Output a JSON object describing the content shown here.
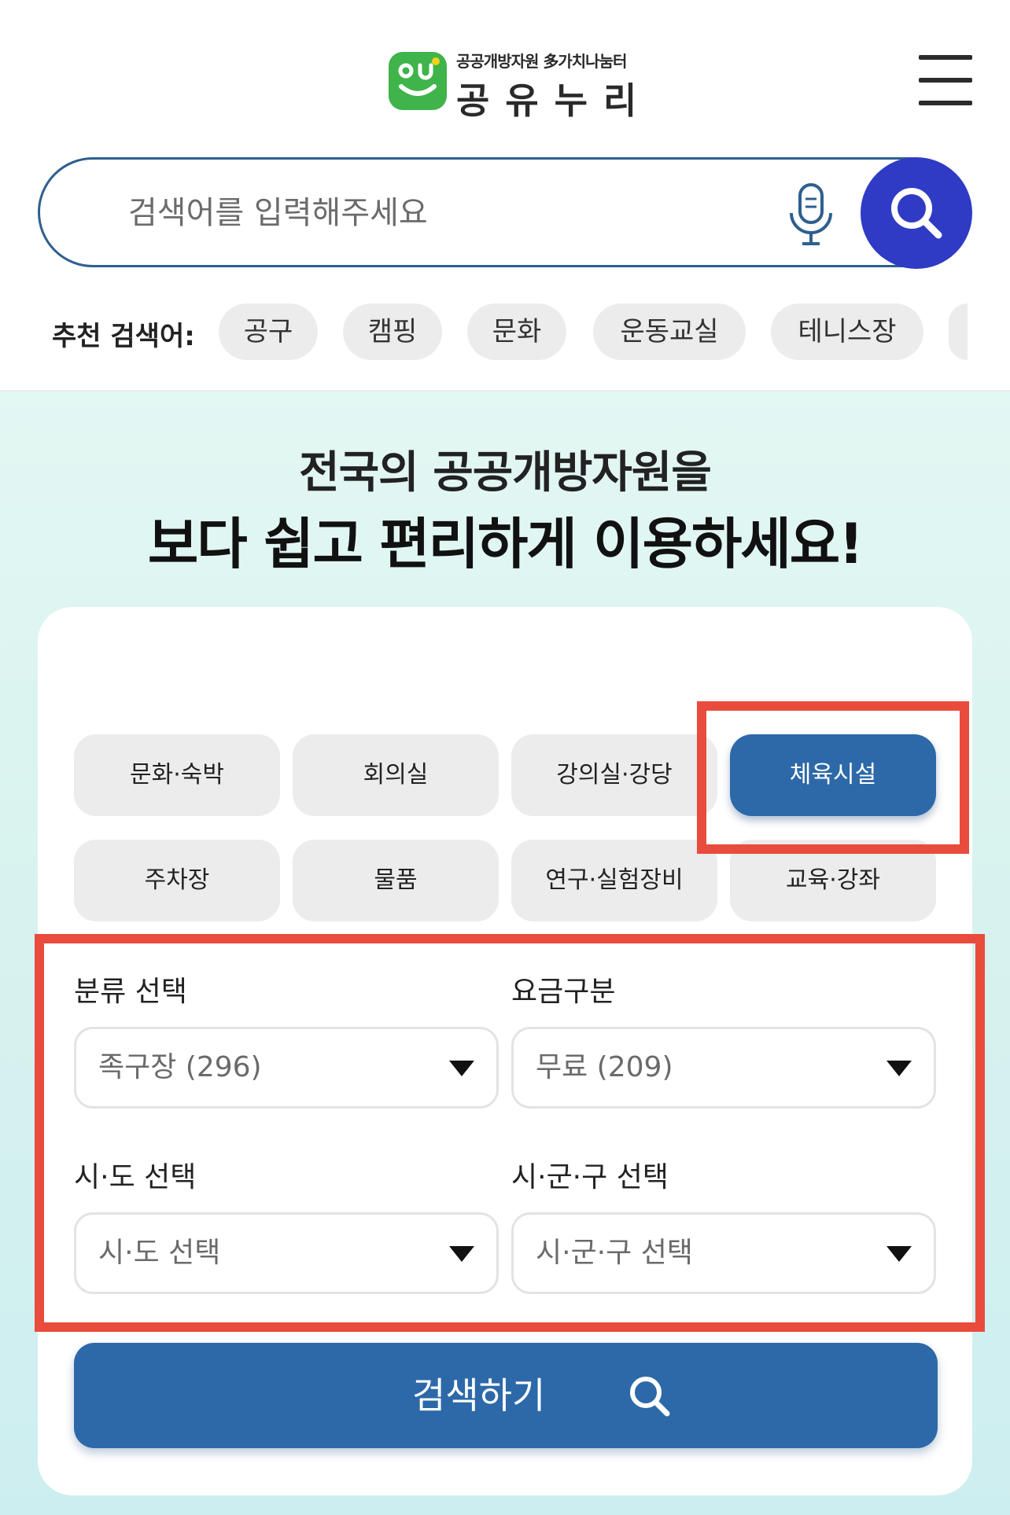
{
  "header": {
    "logo_subtitle": "공공개방자원 多가치나눔터",
    "logo_title": "공유누리",
    "logo_badge_text": "ou",
    "menu_icon": "hamburger-icon"
  },
  "search": {
    "placeholder": "검색어를 입력해주세요",
    "mic_icon": "microphone-icon",
    "search_icon": "search-icon",
    "accent_color": "#2f3bc4"
  },
  "recommended": {
    "label": "추천 검색어:",
    "items": [
      "공구",
      "캠핑",
      "문화",
      "운동교실",
      "테니스장"
    ]
  },
  "hero": {
    "line1": "전국의 공공개방자원을",
    "line2": "보다 쉽고 편리하게 이용하세요!"
  },
  "categories": {
    "items": [
      "문화·숙박",
      "회의실",
      "강의실·강당",
      "체육시설",
      "주차장",
      "물품",
      "연구·실험장비",
      "교육·강좌"
    ],
    "active": "체육시설",
    "active_color": "#2d69a8"
  },
  "filters": {
    "category_label": "분류 선택",
    "category_value": "족구장 (296)",
    "fee_label": "요금구분",
    "fee_value": "무료 (209)",
    "province_label": "시·도 선택",
    "province_value": "시·도 선택",
    "district_label": "시·군·구 선택",
    "district_value": "시·군·구 선택"
  },
  "submit": {
    "label": "검색하기"
  },
  "highlight_color": "#e94b3c"
}
